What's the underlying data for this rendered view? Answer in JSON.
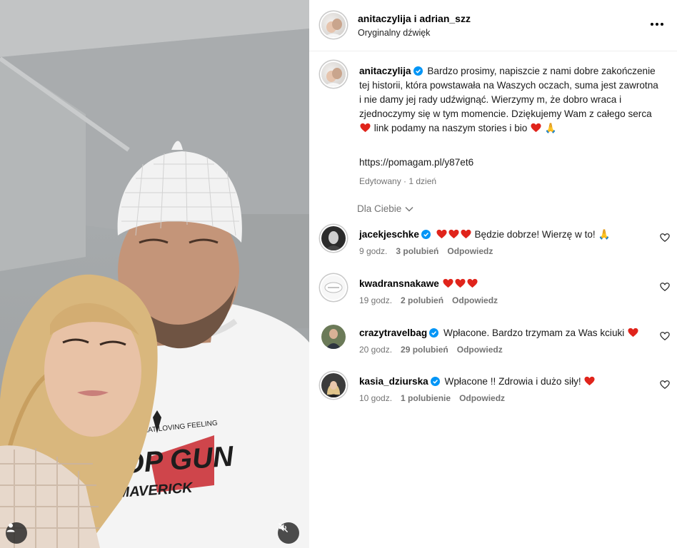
{
  "post": {
    "authors": "anitaczylija i adrian_szz",
    "audio": "Oryginalny dźwięk",
    "more_icon": "more-horizontal-icon"
  },
  "photo": {
    "shirt_line": "AINBACK THAT LOVING FEELING",
    "shirt_title": "TOP GUN",
    "shirt_subtitle": "MAVERICK"
  },
  "caption": {
    "username": "anitaczylija",
    "text_part1": "Bardzo prosimy, napiszcie z nami dobre zakończenie tej historii, która powstawała na Waszych oczach, suma jest zawrotna i nie damy jej rady udźwignąć. Wierzymy m, że dobro wraca i zjednoczymy się w tym momencie. Dziękujemy Wam z całego serca",
    "text_part2": "link podamy na naszym stories i bio",
    "prayer_emoji": "🙏",
    "link": "https://pomagam.pl/y87et6",
    "meta": "Edytowany · 1 dzień"
  },
  "filter": {
    "label": "Dla Ciebie"
  },
  "comments": [
    {
      "user": "jacekjeschke",
      "verified": true,
      "hearts": 3,
      "text": "Będzie dobrze! Wierzę w to! 🙏",
      "time": "9 godz.",
      "likes": "3 polubień",
      "reply": "Odpowiedz"
    },
    {
      "user": "kwadransnakawe",
      "verified": false,
      "hearts": 3,
      "text": "",
      "time": "19 godz.",
      "likes": "2 polubień",
      "reply": "Odpowiedz"
    },
    {
      "user": "crazytravelbag",
      "verified": true,
      "hearts": 0,
      "text": "Wpłacone. Bardzo trzymam za Was kciuki",
      "trail_heart": true,
      "time": "20 godz.",
      "likes": "29 polubień",
      "reply": "Odpowiedz"
    },
    {
      "user": "kasia_dziurska",
      "verified": true,
      "hearts": 0,
      "text": "Wpłacone !! Zdrowia i dużo siły!",
      "trail_heart": true,
      "time": "10 godz.",
      "likes": "1 polubienie",
      "reply": "Odpowiedz"
    }
  ],
  "colors": {
    "heart": "#e0241b",
    "verified": "#0095f6",
    "muted": "#737373"
  }
}
